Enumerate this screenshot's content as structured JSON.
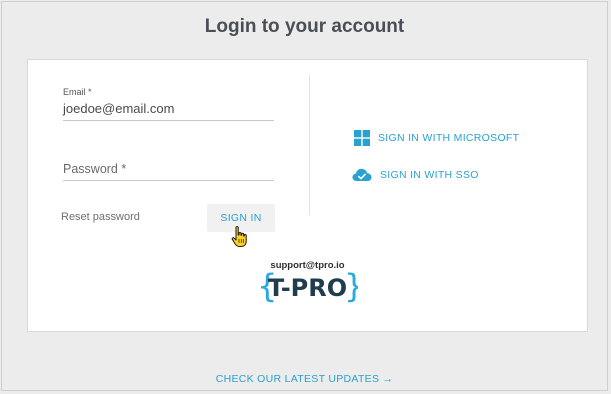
{
  "page": {
    "title": "Login to your account"
  },
  "form": {
    "email_label": "Email *",
    "email_value": "joedoe@email.com",
    "password_label": "Password *",
    "reset_label": "Reset password",
    "signin_label": "SIGN IN"
  },
  "sso": {
    "microsoft_label": "SIGN IN WITH MICROSOFT",
    "sso_label": "SIGN IN WITH SSO"
  },
  "footer": {
    "support_email": "support@tpro.io",
    "logo_text": "T-PRO",
    "updates_label": "CHECK OUR LATEST UPDATES →"
  },
  "colors": {
    "accent": "#2aa1cf",
    "logo_brace": "#29a9e0",
    "logo_text": "#1f3d4d",
    "background": "#ececec",
    "card": "#ffffff"
  },
  "icons": {
    "microsoft": "windows-logo-icon",
    "sso": "cloud-check-icon",
    "cursor": "hand-pointer-icon"
  }
}
